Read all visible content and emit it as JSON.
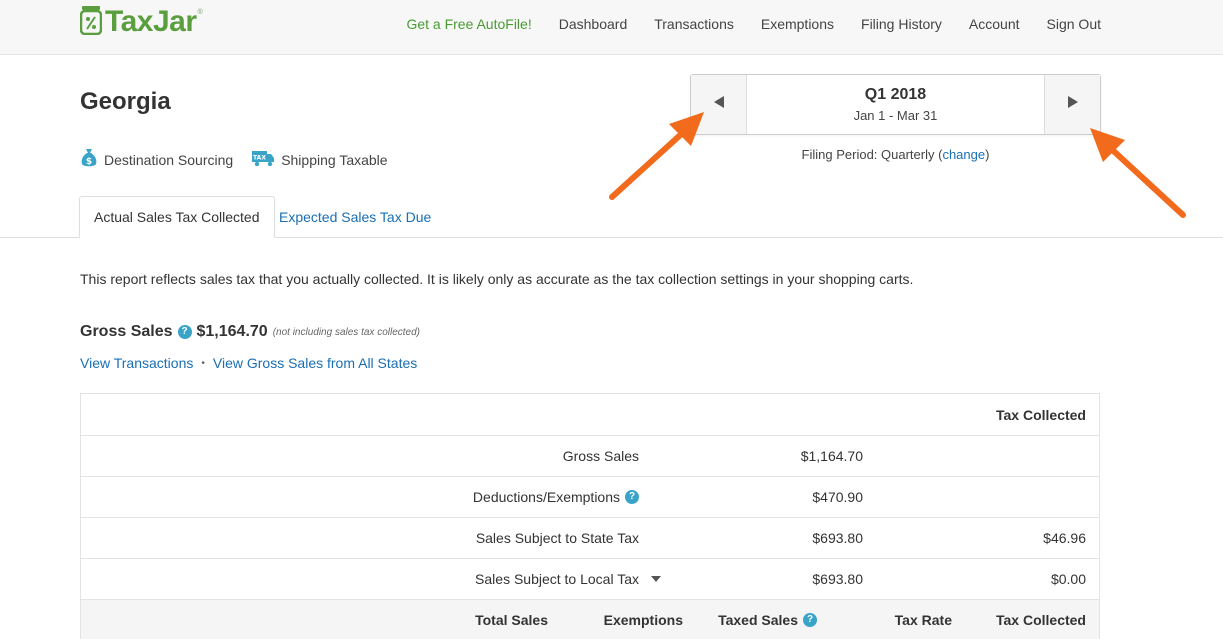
{
  "header": {
    "logo_text": "TaxJar",
    "logo_mark": "®",
    "nav": [
      {
        "label": "Get a Free AutoFile!",
        "promo": true
      },
      {
        "label": "Dashboard"
      },
      {
        "label": "Transactions"
      },
      {
        "label": "Exemptions"
      },
      {
        "label": "Filing History"
      },
      {
        "label": "Account"
      },
      {
        "label": "Sign Out"
      }
    ]
  },
  "page": {
    "state": "Georgia",
    "badges": {
      "destination": "Destination Sourcing",
      "shipping": "Shipping Taxable"
    }
  },
  "period": {
    "quarter": "Q1 2018",
    "range": "Jan 1 - Mar 31",
    "filing_prefix": "Filing Period: Quarterly (",
    "change_link": "change",
    "filing_suffix": ")"
  },
  "tabs": {
    "actual": "Actual Sales Tax Collected",
    "expected": "Expected Sales Tax Due"
  },
  "note": "This report reflects sales tax that you actually collected. It is likely only as accurate as the tax collection settings in your shopping carts.",
  "gross": {
    "label": "Gross Sales",
    "value": "$1,164.70",
    "note": "(not including sales tax collected)",
    "help_glyph": "?"
  },
  "links": {
    "view_transactions": "View Transactions",
    "separator": "•",
    "view_all_states": "View Gross Sales from All States"
  },
  "table": {
    "header_tax_collected": "Tax Collected",
    "rows": [
      {
        "label": "Gross Sales",
        "amount": "$1,164.70",
        "tax": ""
      },
      {
        "label": "Deductions/Exemptions",
        "amount": "$470.90",
        "tax": ""
      },
      {
        "label": "Sales Subject to State Tax",
        "amount": "$693.80",
        "tax": "$46.96"
      },
      {
        "label": "Sales Subject to Local Tax",
        "amount": "$693.80",
        "tax": "$0.00"
      }
    ],
    "sub_headers": {
      "total_sales": "Total Sales",
      "exemptions": "Exemptions",
      "taxed_sales": "Taxed Sales",
      "tax_rate": "Tax Rate",
      "tax_collected": "Tax Collected"
    }
  },
  "colors": {
    "brand_green": "#5a9e3e",
    "link_blue": "#1a6fb4",
    "help_blue": "#3aa4c8",
    "annotation_orange": "#f26a1b"
  }
}
